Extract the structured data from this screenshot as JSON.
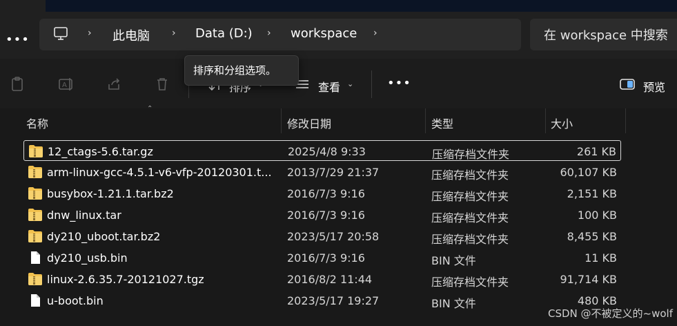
{
  "nav": {
    "more_glyph": "•••",
    "breadcrumbs": [
      "此电脑",
      "Data (D:)",
      "workspace"
    ],
    "separator": "›",
    "search_placeholder": "在 workspace 中搜索"
  },
  "toolbar": {
    "sort_label": "排序",
    "view_label": "查看",
    "more_glyph": "•••",
    "preview_label": "预览",
    "tooltip": "排序和分组选项。"
  },
  "columns": {
    "name": "名称",
    "modified": "修改日期",
    "type": "类型",
    "size": "大小"
  },
  "files": [
    {
      "name": "12_ctags-5.6.tar.gz",
      "modified": "2025/4/8 9:33",
      "type": "压缩存档文件夹",
      "size": "261 KB",
      "icon": "zip-folder-icon"
    },
    {
      "name": "arm-linux-gcc-4.5.1-v6-vfp-20120301.t...",
      "modified": "2013/7/29 21:37",
      "type": "压缩存档文件夹",
      "size": "60,107 KB",
      "icon": "zip-folder-icon"
    },
    {
      "name": "busybox-1.21.1.tar.bz2",
      "modified": "2016/7/3 9:16",
      "type": "压缩存档文件夹",
      "size": "2,151 KB",
      "icon": "zip-folder-icon"
    },
    {
      "name": "dnw_linux.tar",
      "modified": "2016/7/3 9:16",
      "type": "压缩存档文件夹",
      "size": "100 KB",
      "icon": "zip-folder-icon"
    },
    {
      "name": "dy210_uboot.tar.bz2",
      "modified": "2023/5/17 20:58",
      "type": "压缩存档文件夹",
      "size": "8,455 KB",
      "icon": "zip-folder-icon"
    },
    {
      "name": "dy210_usb.bin",
      "modified": "2016/7/3 9:16",
      "type": "BIN 文件",
      "size": "11 KB",
      "icon": "file-icon"
    },
    {
      "name": "linux-2.6.35.7-20121027.tgz",
      "modified": "2016/8/2 11:44",
      "type": "压缩存档文件夹",
      "size": "91,714 KB",
      "icon": "zip-folder-icon"
    },
    {
      "name": "u-boot.bin",
      "modified": "2023/5/17 19:27",
      "type": "BIN 文件",
      "size": "480 KB",
      "icon": "file-icon"
    }
  ],
  "watermark": "CSDN @不被定义的~wolf",
  "colors": {
    "background": "#191919",
    "folder": "#f2c14e",
    "focus_border": "#d8d8d8"
  }
}
